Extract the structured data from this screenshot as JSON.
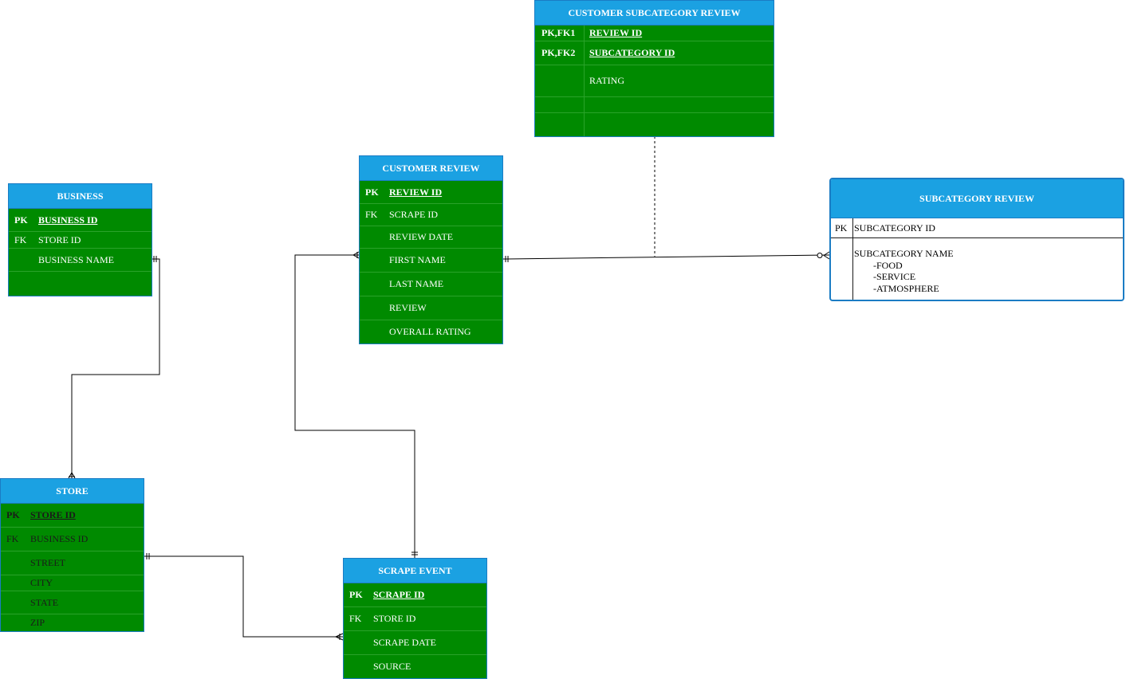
{
  "entities": {
    "customer_subcategory_review": {
      "title": "CUSTOMER SUBCATEGORY REVIEW",
      "rows": [
        {
          "key": "PK,FK1",
          "name": "REVIEW ID"
        },
        {
          "key": "PK,FK2",
          "name": "SUBCATEGORY ID"
        },
        {
          "key": "",
          "name": "RATING"
        },
        {
          "key": "",
          "name": ""
        },
        {
          "key": "",
          "name": ""
        }
      ]
    },
    "customer_review": {
      "title": "CUSTOMER REVIEW",
      "rows": [
        {
          "key": "PK",
          "name": "REVIEW ID"
        },
        {
          "key": "FK",
          "name": "SCRAPE ID"
        },
        {
          "key": "",
          "name": "REVIEW DATE"
        },
        {
          "key": "",
          "name": "FIRST NAME"
        },
        {
          "key": "",
          "name": "LAST NAME"
        },
        {
          "key": "",
          "name": "REVIEW"
        },
        {
          "key": "",
          "name": "OVERALL RATING"
        }
      ]
    },
    "business": {
      "title": "BUSINESS",
      "rows": [
        {
          "key": "PK",
          "name": "BUSINESS ID"
        },
        {
          "key": "FK",
          "name": "STORE ID"
        },
        {
          "key": "",
          "name": "BUSINESS NAME"
        },
        {
          "key": "",
          "name": ""
        }
      ]
    },
    "subcategory_review": {
      "title": "SUBCATEGORY REVIEW",
      "pk_key": "PK",
      "pk_name": "SUBCATEGORY ID",
      "attr_name": "SUBCATEGORY NAME",
      "options": [
        "-FOOD",
        "-SERVICE",
        "-ATMOSPHERE"
      ]
    },
    "store": {
      "title": "STORE",
      "rows": [
        {
          "key": "PK",
          "name": "STORE ID"
        },
        {
          "key": "FK",
          "name": "BUSINESS ID"
        },
        {
          "key": "",
          "name": "STREET"
        },
        {
          "key": "",
          "name": "CITY"
        },
        {
          "key": "",
          "name": "STATE"
        },
        {
          "key": "",
          "name": "ZIP"
        }
      ]
    },
    "scrape_event": {
      "title": "SCRAPE EVENT",
      "rows": [
        {
          "key": "PK",
          "name": "SCRAPE ID"
        },
        {
          "key": "FK",
          "name": "STORE ID"
        },
        {
          "key": "",
          "name": "SCRAPE DATE"
        },
        {
          "key": "",
          "name": "SOURCE"
        }
      ]
    }
  },
  "colors": {
    "header": "#1ba1e2",
    "body": "#008a00",
    "border": "#1b7cc4",
    "line": "#000000"
  }
}
